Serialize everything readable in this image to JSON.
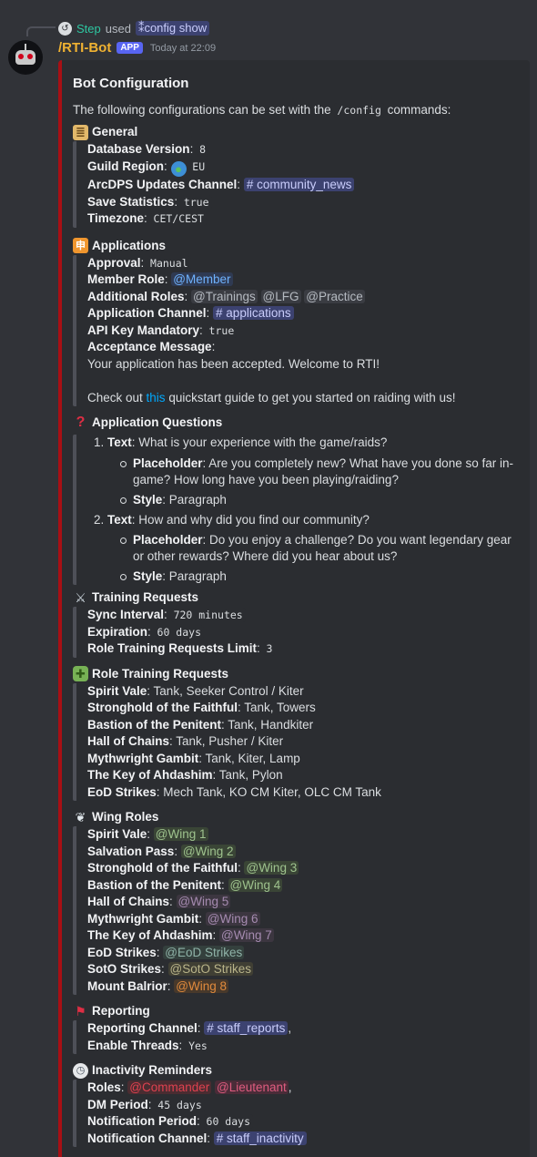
{
  "reply": {
    "user": "Step",
    "verb": "used",
    "command": "config show"
  },
  "message": {
    "bot_name": "/RTI-Bot",
    "tag": "APP",
    "timestamp": "Today at 22:09"
  },
  "embed": {
    "title": "Bot Configuration",
    "desc_pre": "The following configurations can be set with the ",
    "desc_cmd": "/config",
    "desc_post": " commands:",
    "general": {
      "heading": "General",
      "db_label": "Database Version",
      "db_value": "8",
      "region_label": "Guild Region",
      "region_value": "EU",
      "arc_label": "ArcDPS Updates Channel",
      "arc_value": "community_news",
      "save_label": "Save Statistics",
      "save_value": "true",
      "tz_label": "Timezone",
      "tz_value": "CET/CEST"
    },
    "applications": {
      "heading": "Applications",
      "approval_label": "Approval",
      "approval_value": "Manual",
      "member_label": "Member Role",
      "member_value": "@Member",
      "add_label": "Additional Roles",
      "add_values": [
        "@Trainings",
        "@LFG",
        "@Practice"
      ],
      "chan_label": "Application Channel",
      "chan_value": "applications",
      "api_label": "API Key Mandatory",
      "api_value": "true",
      "accept_label": "Acceptance Message",
      "accept_line1": "Your application has been accepted. Welcome to RTI!",
      "accept_line2_pre": "Check out ",
      "accept_line2_link": "this",
      "accept_line2_post": " quickstart guide to get you started on raiding with us!"
    },
    "questions": {
      "heading": "Application Questions",
      "text_label": "Text",
      "placeholder_label": "Placeholder",
      "style_label": "Style",
      "items": [
        {
          "text": "What is your experience with the game/raids?",
          "placeholder": "Are you completely new? What have you done so far in-game? How long have you been playing/raiding?",
          "style": "Paragraph"
        },
        {
          "text": "How and why did you find our community?",
          "placeholder": "Do you enjoy a challenge? Do you want legendary gear or other rewards? Where did you hear about us?",
          "style": "Paragraph"
        }
      ]
    },
    "training": {
      "heading": "Training Requests",
      "sync_label": "Sync Interval",
      "sync_value": "720 minutes",
      "exp_label": "Expiration",
      "exp_value": "60 days",
      "limit_label": "Role Training Requests Limit",
      "limit_value": "3"
    },
    "role_training": {
      "heading": "Role Training Requests",
      "items": [
        {
          "label": "Spirit Vale",
          "value": "Tank, Seeker Control / Kiter"
        },
        {
          "label": "Stronghold of the Faithful",
          "value": "Tank, Towers"
        },
        {
          "label": "Bastion of the Penitent",
          "value": "Tank, Handkiter"
        },
        {
          "label": "Hall of Chains",
          "value": "Tank, Pusher / Kiter"
        },
        {
          "label": "Mythwright Gambit",
          "value": "Tank, Kiter, Lamp"
        },
        {
          "label": "The Key of Ahdashim",
          "value": "Tank, Pylon"
        },
        {
          "label": "EoD Strikes",
          "value": "Mech Tank, KO CM Kiter, OLC CM Tank"
        }
      ]
    },
    "wing_roles": {
      "heading": "Wing Roles",
      "items": [
        {
          "label": "Spirit Vale",
          "value": "@Wing 1",
          "color": "#9ec28d",
          "bg": "#3a4536"
        },
        {
          "label": "Salvation Pass",
          "value": "@Wing 2",
          "color": "#9ec28d",
          "bg": "#3a4536"
        },
        {
          "label": "Stronghold of the Faithful",
          "value": "@Wing 3",
          "color": "#9ec28d",
          "bg": "#3a4536"
        },
        {
          "label": "Bastion of the Penitent",
          "value": "@Wing 4",
          "color": "#9ec28d",
          "bg": "#3a4536"
        },
        {
          "label": "Hall of Chains",
          "value": "@Wing 5",
          "color": "#a58bb0",
          "bg": "#3c3640"
        },
        {
          "label": "Mythwright Gambit",
          "value": "@Wing 6",
          "color": "#a58bb0",
          "bg": "#3c3640"
        },
        {
          "label": "The Key of Ahdashim",
          "value": "@Wing 7",
          "color": "#a58bb0",
          "bg": "#3c3640"
        },
        {
          "label": "EoD Strikes",
          "value": "@EoD Strikes",
          "color": "#8fb3a8",
          "bg": "#34403d"
        },
        {
          "label": "SotO Strikes",
          "value": "@SotO Strikes",
          "color": "#b9b48a",
          "bg": "#403f34"
        },
        {
          "label": "Mount Balrior",
          "value": "@Wing 8",
          "color": "#e08a3c",
          "bg": "#48392b"
        }
      ]
    },
    "reporting": {
      "heading": "Reporting",
      "chan_label": "Reporting Channel",
      "chan_value": "staff_reports",
      "threads_label": "Enable Threads",
      "threads_value": "Yes"
    },
    "inactivity": {
      "heading": "Inactivity Reminders",
      "roles_label": "Roles",
      "role1": "@Commander",
      "role1_color": "#e0414f",
      "role1_bg": "#4a2c31",
      "role2": "@Lieutenant",
      "role2_color": "#e05c80",
      "role2_bg": "#4a2c38",
      "dm_label": "DM Period",
      "dm_value": "45 days",
      "notif_label": "Notification Period",
      "notif_value": "60 days",
      "notif_chan_label": "Notification Channel",
      "notif_chan_value": "staff_inactivity"
    }
  },
  "colors": {
    "accent": "#a80f14",
    "bot_name": "#f0b232",
    "app_tag": "#5865f2",
    "link": "#00a8fc",
    "channel": "#c9cdfb"
  },
  "icons": [
    "scroll-icon",
    "globe-icon",
    "application-icon",
    "question-icon",
    "swords-icon",
    "puzzle-icon",
    "wing-icon",
    "flag-icon",
    "clock-icon"
  ]
}
